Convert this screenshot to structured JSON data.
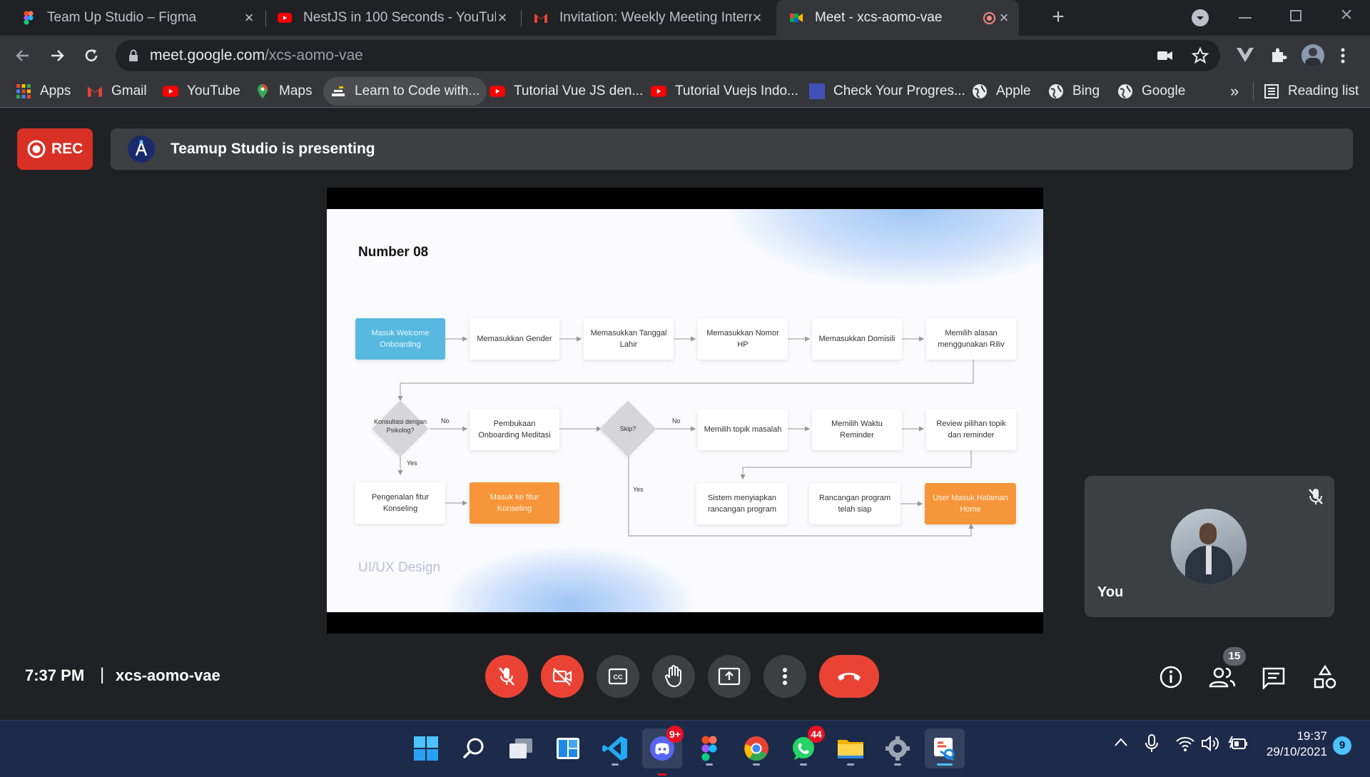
{
  "tabs": [
    {
      "title": "Team Up Studio – Figma",
      "icon": "figma-icon"
    },
    {
      "title": "NestJS in 100 Seconds - YouTube",
      "icon": "youtube-icon"
    },
    {
      "title": "Invitation: Weekly Meeting Internal",
      "icon": "gmail-icon"
    },
    {
      "title": "Meet - xcs-aomo-vae",
      "icon": "meet-icon",
      "active": true
    }
  ],
  "address": {
    "host": "meet.google.com",
    "path": "/xcs-aomo-vae"
  },
  "bookmarks": [
    {
      "label": "Apps",
      "icon": "apps-grid-icon"
    },
    {
      "label": "Gmail",
      "icon": "gmail-icon"
    },
    {
      "label": "YouTube",
      "icon": "youtube-icon"
    },
    {
      "label": "Maps",
      "icon": "maps-pin-icon"
    },
    {
      "label": "Learn to Code with...",
      "icon": "freecodecamp-icon"
    },
    {
      "label": "Tutorial Vue JS den...",
      "icon": "youtube-icon"
    },
    {
      "label": "Tutorial Vuejs Indo...",
      "icon": "youtube-icon"
    },
    {
      "label": "Check Your Progres...",
      "icon": "page-icon"
    },
    {
      "label": "Apple",
      "icon": "globe-icon"
    },
    {
      "label": "Bing",
      "icon": "globe-icon"
    },
    {
      "label": "Google",
      "icon": "globe-icon"
    }
  ],
  "bookmarks_overflow": "»",
  "reading_list": "Reading list",
  "meet": {
    "rec_label": "REC",
    "presenting_text": "Teamup Studio is presenting",
    "self_label": "You",
    "time": "7:37 PM",
    "separator": "|",
    "meeting_code": "xcs-aomo-vae",
    "participants_count": "15"
  },
  "slide": {
    "title": "Number 08",
    "footer": "UI/UX Design",
    "row1": [
      "Masuk Welcome Onboarding",
      "Memasukkan Gender",
      "Memasukkan Tanggal Lahir",
      "Memasukkan Nomor HP",
      "Memasukkan Domisili",
      "Memilih alasan menggunakan Riliv"
    ],
    "decision1": "Konsultasi dengan Psikolog?",
    "decision2": "Skip?",
    "node_onboarding_meditasi": "Pembukaan Onboarding Meditasi",
    "node_topik": "Memilih topik masalah",
    "node_waktu": "Memilih Waktu Reminder",
    "node_review": "Review pilihan topik dan reminder",
    "node_pengenalan": "Pengenalan fitur Konseling",
    "node_masuk_konseling": "Masuk ke fitur Konseling",
    "node_sistem": "Sistem menyiapkan rancangan program",
    "node_rancangan": "Rancangan program telah siap",
    "node_home": "User Masuk Halaman Home",
    "label_no": "No",
    "label_yes": "Yes"
  },
  "taskbar": {
    "discord_badge": "9+",
    "whatsapp_badge": "44",
    "clock_time": "19:37",
    "clock_date": "29/10/2021",
    "notification_count": "9"
  },
  "colors": {
    "rec_red": "#d93025",
    "end_call_red": "#ea4335",
    "flow_blue": "#57b9e0",
    "flow_orange": "#f7953a"
  }
}
